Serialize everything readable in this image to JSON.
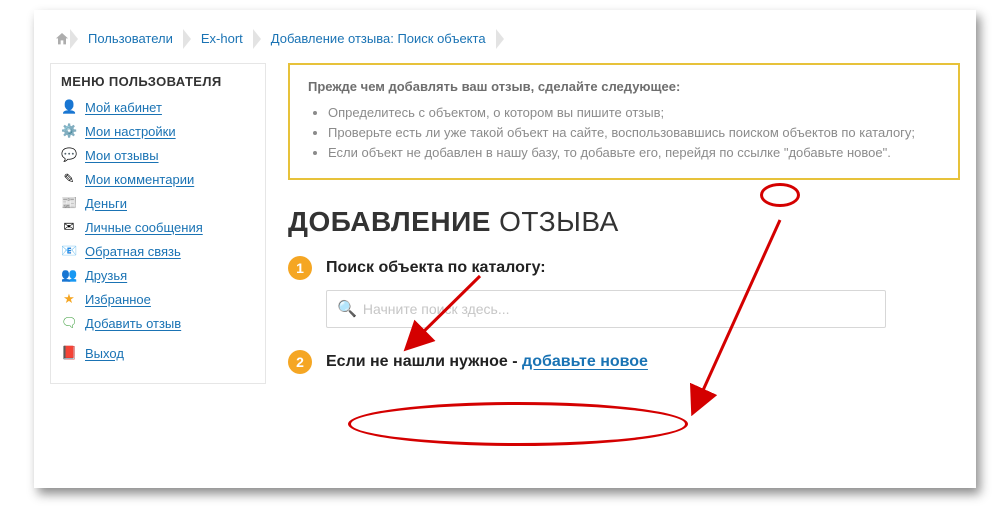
{
  "breadcrumb": {
    "users": "Пользователи",
    "user": "Ex-hort",
    "here": "Добавление отзыва: Поиск объекта"
  },
  "sidebar": {
    "title": "МЕНЮ ПОЛЬЗОВАТЕЛЯ",
    "items": [
      {
        "label": "Мой кабинет",
        "icon": "👤"
      },
      {
        "label": "Мои настройки",
        "icon": "⚙️"
      },
      {
        "label": "Мои отзывы",
        "icon": "💬"
      },
      {
        "label": "Мои комментарии",
        "icon": "✎"
      },
      {
        "label": "Деньги",
        "icon": "📰"
      },
      {
        "label": "Личные сообщения",
        "icon": "✉"
      },
      {
        "label": "Обратная связь",
        "icon": "📧"
      },
      {
        "label": "Друзья",
        "icon": "👥"
      },
      {
        "label": "Избранное",
        "icon": "★"
      },
      {
        "label": "Добавить отзыв",
        "icon": "🗨"
      },
      {
        "label": "Выход",
        "icon": "📕"
      }
    ]
  },
  "notice": {
    "lead": "Прежде чем добавлять ваш отзыв, сделайте следующее:",
    "bullets": [
      "Определитесь с объектом, о котором вы пишите отзыв;",
      "Проверьте есть ли уже такой объект на сайте, воспользовавшись поиском объектов по каталогу;",
      "Если объект не добавлен в нашу базу, то добавьте его, перейдя по ссылке \"добавьте новое\"."
    ]
  },
  "h1": {
    "bold": "ДОБАВЛЕНИЕ",
    "light": "ОТЗЫВА"
  },
  "steps": {
    "one": {
      "num": "1",
      "label": "Поиск объекта по каталогу:"
    },
    "two": {
      "num": "2",
      "label_prefix": "Если не нашли нужное - ",
      "link": "добавьте новое"
    }
  },
  "search": {
    "placeholder": "Начните поиск здесь..."
  }
}
